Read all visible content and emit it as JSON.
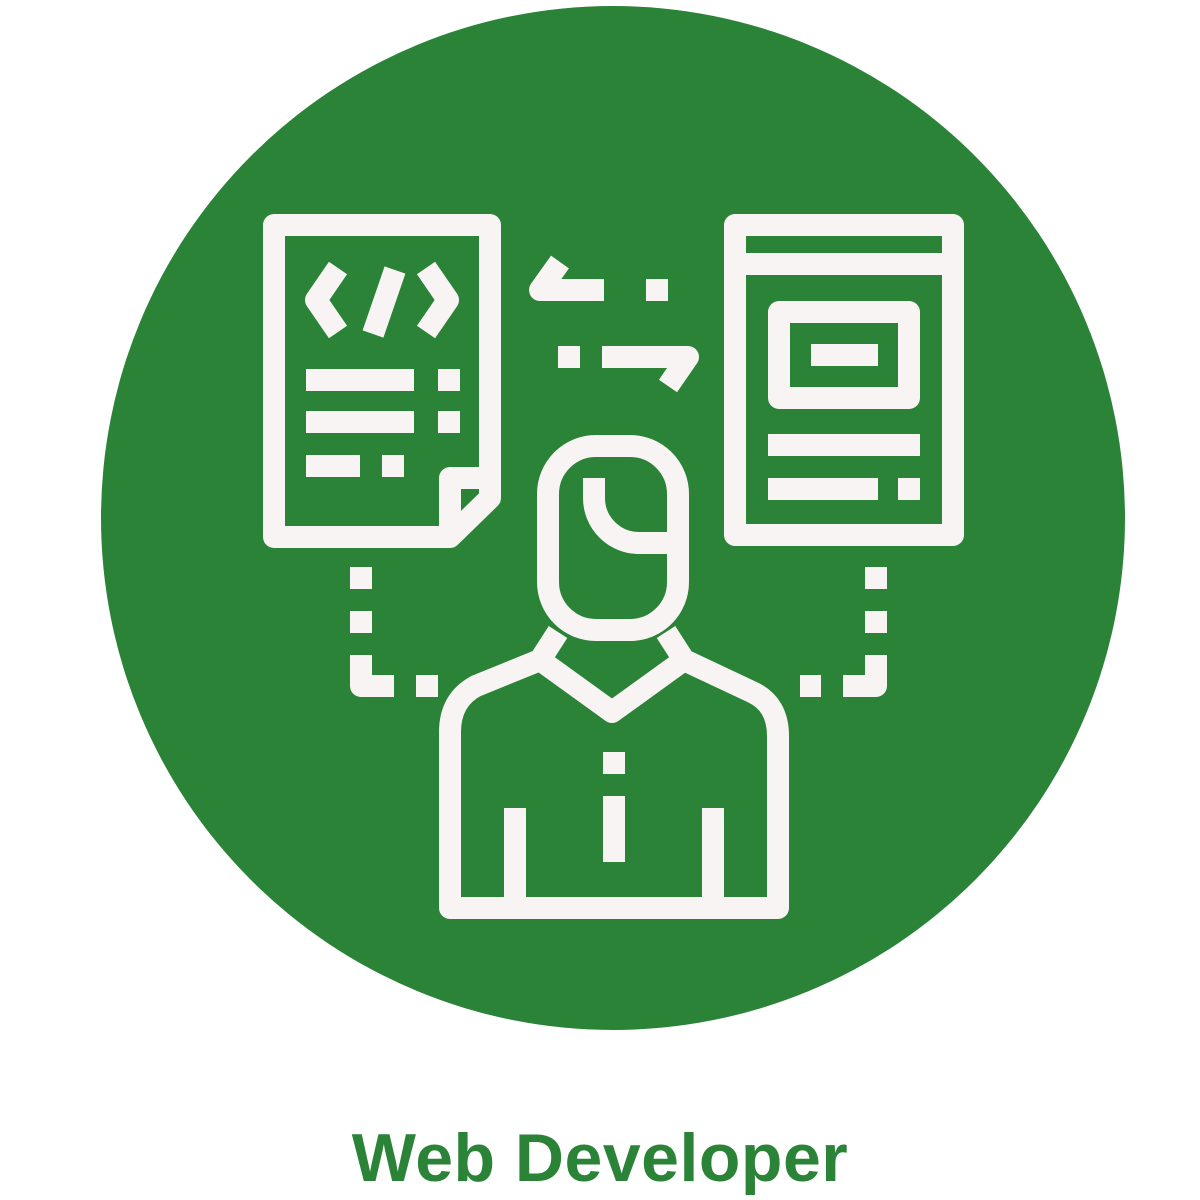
{
  "role": {
    "title": "Web Developer",
    "icon": "web-developer-icon"
  },
  "colors": {
    "circle": "#2a8337",
    "glyph": "#f8f4f4",
    "caption": "#2a8337",
    "background": "#ffffff"
  }
}
